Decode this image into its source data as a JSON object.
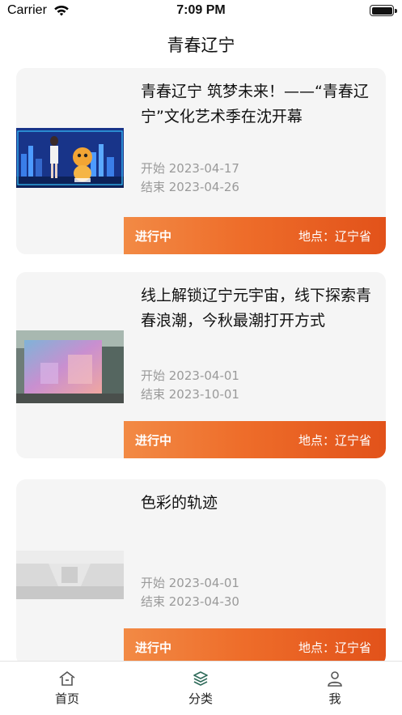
{
  "status_bar": {
    "carrier": "Carrier",
    "time": "7:09 PM"
  },
  "nav": {
    "title": "青春辽宁"
  },
  "events": [
    {
      "title": "青春辽宁 筑梦未来！——“青春辽宁”文化艺术季在沈开幕",
      "start": "开始 2023-04-17",
      "end": "结束 2023-04-26",
      "status": "进行中",
      "location": "地点：辽宁省"
    },
    {
      "title": "线上解锁辽宁元宇宙，线下探索青春浪潮，今秋最潮打开方式",
      "start": "开始 2023-04-01",
      "end": "结束 2023-10-01",
      "status": "进行中",
      "location": "地点：辽宁省"
    },
    {
      "title": "色彩的轨迹",
      "start": "开始 2023-04-01",
      "end": "结束 2023-04-30",
      "status": "进行中",
      "location": "地点：辽宁省"
    }
  ],
  "tabbar": {
    "items": [
      {
        "label": "首页",
        "icon": "home-icon"
      },
      {
        "label": "分类",
        "icon": "layers-icon"
      },
      {
        "label": "我",
        "icon": "user-icon"
      }
    ],
    "active_color": "#2f6b5a"
  },
  "colors": {
    "accent_start": "#f28a45",
    "accent_end": "#e2521a",
    "card_bg": "#f5f5f5"
  }
}
